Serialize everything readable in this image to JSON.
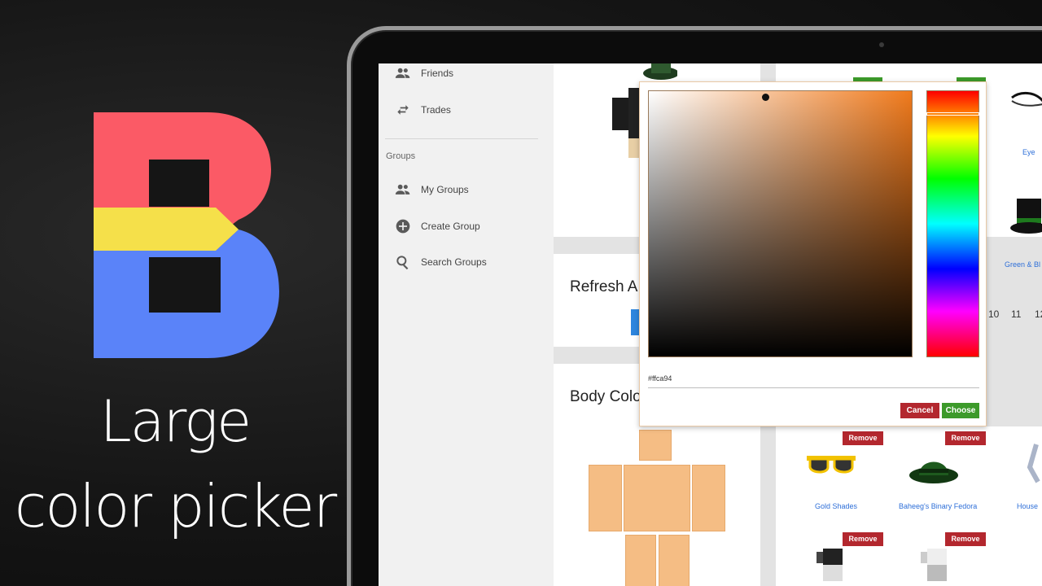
{
  "promo": {
    "tagline_line1": "Large",
    "tagline_line2": "color picker",
    "logo_colors": {
      "top": "#fb5a66",
      "middle": "#f5e04a",
      "bottom": "#5a83f9"
    }
  },
  "sidebar": {
    "items": [
      {
        "label": "Friends",
        "icon": "friends-icon"
      },
      {
        "label": "Trades",
        "icon": "trade-arrows-icon"
      }
    ],
    "groups_heading": "Groups",
    "group_items": [
      {
        "label": "My Groups",
        "icon": "groups-icon"
      },
      {
        "label": "Create Group",
        "icon": "plus-circle-icon"
      },
      {
        "label": "Search Groups",
        "icon": "search-icon"
      }
    ]
  },
  "main": {
    "refresh_title": "Refresh A",
    "body_colors_title": "Body Colo",
    "body_color": "#f5bd84",
    "page_numbers": [
      "10",
      "11",
      "12"
    ],
    "items_top": [
      {
        "name": "Eye"
      },
      {
        "name": "Green & Bl"
      }
    ],
    "items_bottom": [
      {
        "name": "Gold Shades",
        "remove_label": "Remove"
      },
      {
        "name": "Baheeg's Binary Fedora",
        "remove_label": "Remove"
      },
      {
        "name": "House",
        "remove_label": ""
      }
    ],
    "extra_remove_labels": [
      "Remove",
      "Remove"
    ]
  },
  "color_picker": {
    "hex_value": "#ffca94",
    "hue_color": "#f07a1c",
    "cancel_label": "Cancel",
    "choose_label": "Choose"
  }
}
